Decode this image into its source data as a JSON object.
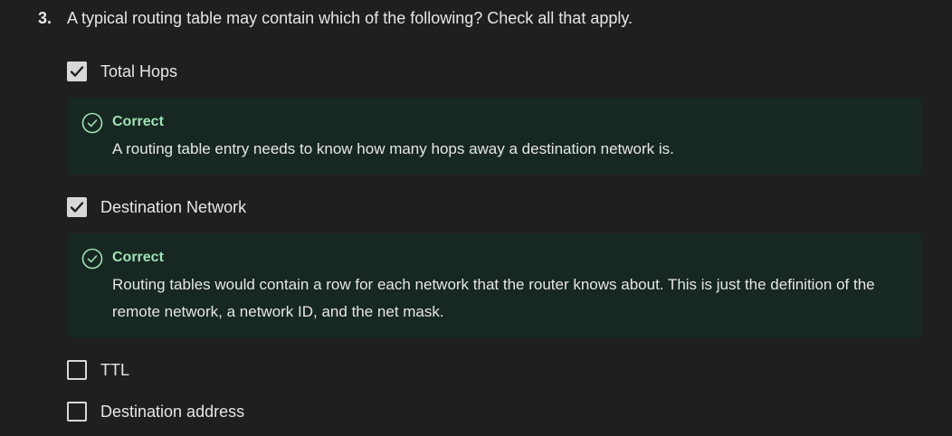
{
  "question": {
    "number": "3.",
    "text": "A typical routing table may contain which of the following? Check all that apply."
  },
  "options": [
    {
      "label": "Total Hops",
      "checked": true,
      "feedback": {
        "title": "Correct",
        "text": "A routing table entry needs to know how many hops away a destination network is."
      }
    },
    {
      "label": "Destination Network",
      "checked": true,
      "feedback": {
        "title": "Correct",
        "text": "Routing tables would contain a row for each network that the router knows about. This is just the definition of the remote network, a network ID, and the net mask."
      }
    },
    {
      "label": "TTL",
      "checked": false
    },
    {
      "label": "Destination address",
      "checked": false
    }
  ],
  "colors": {
    "background": "#1f1f1f",
    "feedback_bg": "#172722",
    "correct_green": "#9fe2b5",
    "checkbox": "#d8d8d8"
  },
  "icons": {
    "check": "check-icon",
    "correct": "check-circle-icon"
  }
}
